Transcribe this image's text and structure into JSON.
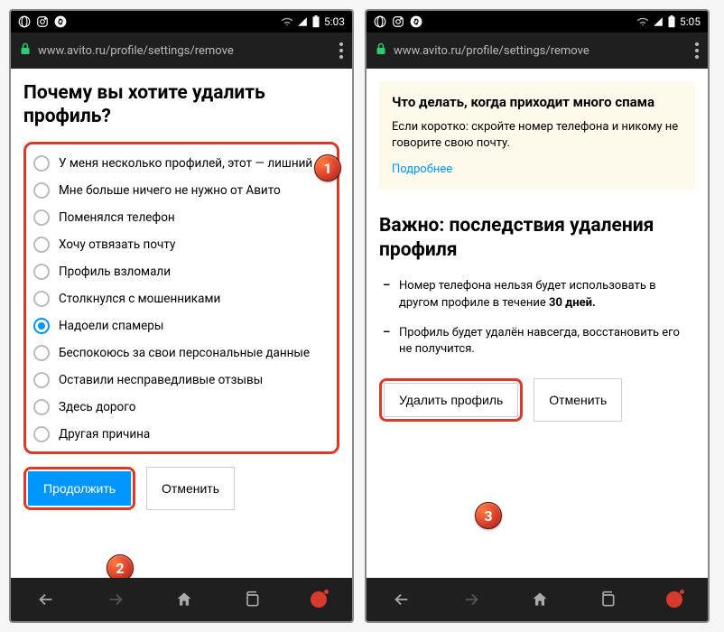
{
  "left": {
    "status_time": "5:03",
    "url": "www.avito.ru/profile/settings/remove",
    "heading": "Почему вы хотите удалить профиль?",
    "options": [
      "У меня несколько профилей, этот — лишний",
      "Мне больше ничего не нужно от Авито",
      "Поменялся телефон",
      "Хочу отвязать почту",
      "Профиль взломали",
      "Столкнулся с мошенниками",
      "Надоели спамеры",
      "Беспокоюсь за свои персональные данные",
      "Оставили несправедливые отзывы",
      "Здесь дорого",
      "Другая причина"
    ],
    "selected_index": 6,
    "continue_btn": "Продолжить",
    "cancel_btn": "Отменить"
  },
  "right": {
    "status_time": "5:05",
    "url": "www.avito.ru/profile/settings/remove",
    "callout_title": "Что делать, когда приходит много спама",
    "callout_text": "Если коротко: скройте номер телефона и никому не говорите свою почту.",
    "callout_link": "Подробнее",
    "heading": "Важно: последствия удаления профиля",
    "bullet1_a": "Номер телефона нельзя будет использовать в другом профиле в течение ",
    "bullet1_b": "30 дней.",
    "bullet2": "Профиль будет удалён навсегда, восстановить его не получится.",
    "delete_btn": "Удалить профиль",
    "cancel_btn": "Отменить"
  },
  "badges": {
    "b1": "1",
    "b2": "2",
    "b3": "3"
  }
}
